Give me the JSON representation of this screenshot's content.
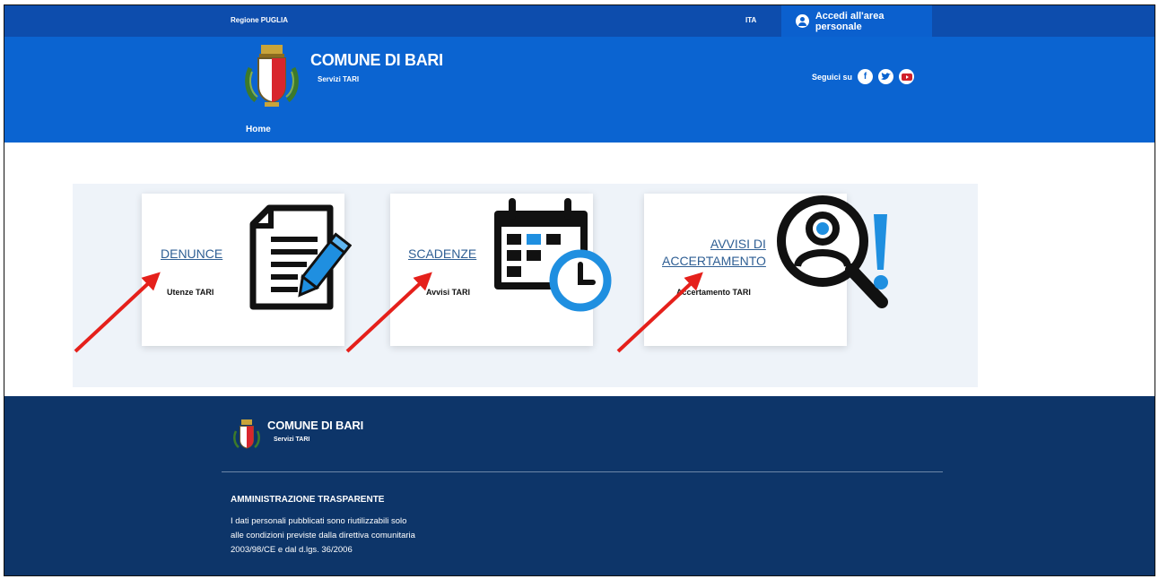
{
  "topbar": {
    "region": "Regione PUGLIA",
    "language": "ITA",
    "login_label": "Accedi all'area personale"
  },
  "header": {
    "title": "COMUNE DI BARI",
    "subtitle": "Servizi TARI",
    "social_label": "Seguici su",
    "social": [
      "facebook-icon",
      "twitter-icon",
      "youtube-icon"
    ]
  },
  "nav": {
    "home": "Home"
  },
  "cards": [
    {
      "title": "DENUNCE",
      "subtitle": "Utenze TARI",
      "icon": "document-edit-icon"
    },
    {
      "title": "SCADENZE",
      "subtitle": "Avvisi TARI",
      "icon": "calendar-clock-icon"
    },
    {
      "title_line1": "AVVISI DI",
      "title_line2": "ACCERTAMENTO",
      "subtitle": "Accertamento TARI",
      "icon": "magnifier-user-alert-icon"
    }
  ],
  "footer": {
    "title": "COMUNE DI BARI",
    "subtitle": "Servizi TARI",
    "section_heading": "AMMINISTRAZIONE TRASPARENTE",
    "section_text": "I dati personali pubblicati sono riutilizzabili solo alle condizioni previste dalla direttiva comunitaria 2003/98/CE e dal d.lgs. 36/2006"
  },
  "colors": {
    "header_blue": "#0b64d1",
    "topbar_blue": "#0d4dad",
    "footer_navy": "#0d3569",
    "accent_light_blue": "#1f8fe0",
    "annotation_arrow": "#e5201b"
  }
}
